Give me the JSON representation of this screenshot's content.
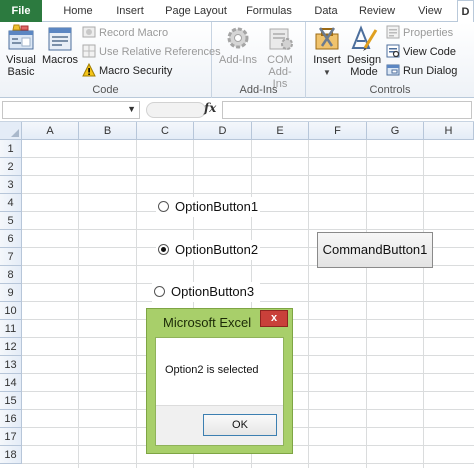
{
  "tabs": [
    "File",
    "Home",
    "Insert",
    "Page Layout",
    "Formulas",
    "Data",
    "Review",
    "View",
    "D"
  ],
  "ribbon": {
    "code": {
      "label": "Code",
      "visual_basic": "Visual Basic",
      "macros": "Macros",
      "record_macro": "Record Macro",
      "use_relative_refs": "Use Relative References",
      "macro_security": "Macro Security"
    },
    "addins": {
      "label": "Add-Ins",
      "add_ins": "Add-Ins",
      "com_add_ins": "COM Add-Ins"
    },
    "controls": {
      "label": "Controls",
      "insert": "Insert",
      "design_mode": "Design Mode",
      "properties": "Properties",
      "view_code": "View Code",
      "run_dialog": "Run Dialog"
    }
  },
  "formula_bar": {
    "fx": "fx"
  },
  "grid": {
    "columns": [
      "A",
      "B",
      "C",
      "D",
      "E",
      "F",
      "G",
      "H"
    ],
    "rows": [
      "1",
      "2",
      "3",
      "4",
      "5",
      "6",
      "7",
      "8",
      "9",
      "10",
      "11",
      "12",
      "13",
      "14",
      "15",
      "16",
      "17",
      "18"
    ]
  },
  "controls": {
    "option1": "OptionButton1",
    "option2": "OptionButton2",
    "option3": "OptionButton3",
    "selected": "OptionButton2",
    "command": "CommandButton1"
  },
  "dialog": {
    "title": "Microsoft Excel",
    "close": "x",
    "message": "Option2 is selected",
    "ok": "OK"
  },
  "colors": {
    "file_tab": "#2c7a3f",
    "dialog_frame": "#a8cf6a",
    "close_button": "#c9403a"
  }
}
